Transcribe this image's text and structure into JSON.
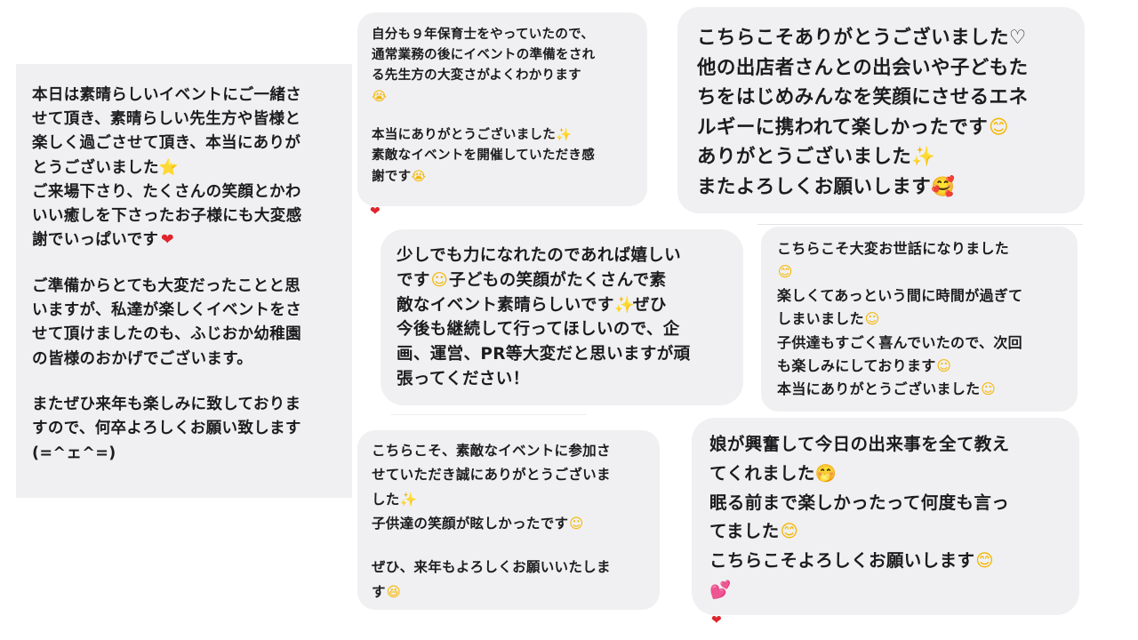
{
  "messages": {
    "b1": {
      "line1": "本日は素晴らしいイベントにご一緒さ",
      "line2": "せて頂き、素晴らしい先生方や皆様と",
      "line3": "楽しく過ごさせて頂き、本当にありが",
      "line4": "とうございました",
      "line5": "ご来場下さり、たくさんの笑顔とかわ",
      "line6": "いい癒しを下さったお子様にも大変感",
      "line7": "謝でいっぱいです",
      "line8": "ご準備からとても大変だったことと思",
      "line9": "いますが、私達が楽しくイベントをさ",
      "line10": "せて頂けましたのも、ふじおか幼稚園",
      "line11": "の皆様のおかげでございます。",
      "line12": "またぜひ来年も楽しみに致しておりま",
      "line13": "すので、何卒よろしくお願い致します",
      "line14": "(=^ェ^=)"
    },
    "b2": {
      "line1": "自分も９年保育士をやっていたので、",
      "line2": "通常業務の後にイベントの準備をされ",
      "line3": "る先生方の大変さがよくわかります",
      "line4": "本当にありがとうございました",
      "line5": "素敵なイベントを開催していただき感",
      "line6": "謝です"
    },
    "b3": {
      "line1": "こちらこそありがとうございました♡",
      "line2": "他の出店者さんとの出会いや子どもた",
      "line3": "ちをはじめみんなを笑顔にさせるエネ",
      "line4": "ルギーに携われて楽しかったです",
      "line5": "ありがとうございました",
      "line6": "またよろしくお願いします"
    },
    "b4": {
      "line1": "少しでも力になれたのであれば嬉しい",
      "line2": "です",
      "line2b": "子どもの笑顔がたくさんで素",
      "line3": "敵なイベント素晴らしいです",
      "line3b": "ぜひ",
      "line4": "今後も継続して行ってほしいので、企",
      "line5": "画、運営、PR等大変だと思いますが頑",
      "line6": "張ってください！"
    },
    "b5": {
      "line1": "こちらこそ大変お世話になりました",
      "line2": "楽しくてあっという間に時間が過ぎて",
      "line3": "しまいました",
      "line4": "子供達もすごく喜んでいたので、次回",
      "line5": "も楽しみにしております",
      "line6": "本当にありがとうございました"
    },
    "b6": {
      "line1": "こちらこそ、素敵なイベントに参加さ",
      "line2": "せていただき誠にありがとうございま",
      "line3": "した",
      "line4": "子供達の笑顔が眩しかったです",
      "line5": "ぜひ、来年もよろしくお願いいたしま",
      "line6": "す"
    },
    "b7": {
      "line1": "娘が興奮して今日の出来事を全て教え",
      "line2": "てくれました",
      "line3": "眠る前まで楽しかったって何度も言っ",
      "line4": "てました",
      "line5": "こちらこそよろしくお願いします"
    }
  },
  "emojis": {
    "star": "⭐",
    "heart": "❤",
    "sparkles": "✨",
    "smile": "☺",
    "happy": "😊",
    "cry": "😭",
    "blush": "🥰",
    "grin": "😆",
    "hush": "🤭",
    "pink_hearts": "💕",
    "reaction_heart": "❤"
  },
  "colors": {
    "bubble_bg": "#f0f0f2",
    "text": "#1c1c1e",
    "emoji_yellow": "#f5b600",
    "heart_red": "#e0242b",
    "heart_pink": "#f07aa6"
  }
}
